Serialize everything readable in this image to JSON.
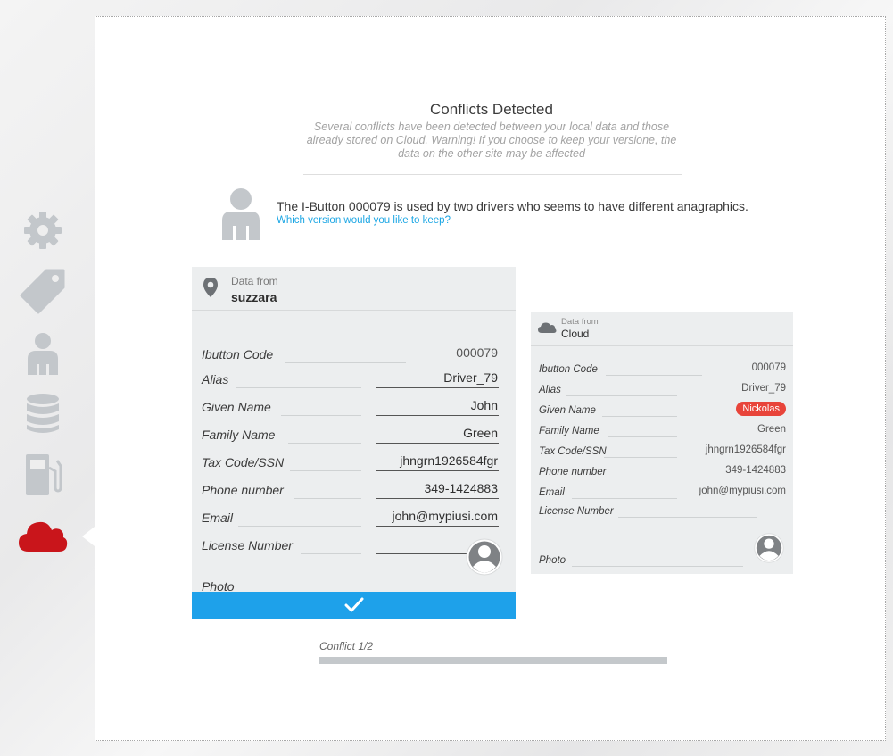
{
  "sidebar": {
    "items": [
      {
        "name": "settings",
        "icon": "gear-icon"
      },
      {
        "name": "tags",
        "icon": "tag-icon"
      },
      {
        "name": "drivers",
        "icon": "person-icon"
      },
      {
        "name": "database",
        "icon": "database-icon"
      },
      {
        "name": "fuel",
        "icon": "fuel-pump-icon"
      },
      {
        "name": "cloud",
        "icon": "cloud-icon",
        "active": true
      }
    ],
    "active_color": "#c9151b",
    "inactive_color": "#c3c7cb"
  },
  "header": {
    "title": "Conflicts Detected",
    "subtitle": "Several conflicts have been detected between your local data and those already stored on Cloud. Warning! If you choose to keep your versione, the data on the other site may be affected"
  },
  "notice": {
    "text": "The I-Button 000079 is used by two drivers who seems to have different anagraphics.",
    "question": "Which version would you like to keep?"
  },
  "local_card": {
    "source_label": "Data from",
    "source_name": "suzzara",
    "fields": [
      {
        "label": "Ibutton Code",
        "value": "000079"
      },
      {
        "label": "Alias",
        "value": "Driver_79"
      },
      {
        "label": "Given Name",
        "value": "John"
      },
      {
        "label": "Family Name",
        "value": "Green"
      },
      {
        "label": "Tax Code/SSN",
        "value": "jhngrn1926584fgr"
      },
      {
        "label": "Phone number",
        "value": "349-1424883"
      },
      {
        "label": "Email",
        "value": "john@mypiusi.com"
      },
      {
        "label": "License Number",
        "value": ""
      },
      {
        "label": "Photo",
        "value": ""
      }
    ],
    "confirm_icon": "checkmark-icon"
  },
  "cloud_card": {
    "source_label": "Data from",
    "source_name": "Cloud",
    "fields": [
      {
        "label": "Ibutton Code",
        "value": "000079"
      },
      {
        "label": "Alias",
        "value": "Driver_79"
      },
      {
        "label": "Given Name",
        "value": "Nickolas"
      },
      {
        "label": "Family Name",
        "value": "Green"
      },
      {
        "label": "Tax Code/SSN",
        "value": "jhngrn1926584fgr"
      },
      {
        "label": "Phone number",
        "value": "349-1424883"
      },
      {
        "label": "Email",
        "value": "john@mypiusi.com"
      },
      {
        "label": "License Number",
        "value": ""
      },
      {
        "label": "Photo",
        "value": ""
      }
    ]
  },
  "progress": {
    "label": "Conflict 1/2",
    "current": 1,
    "total": 2
  },
  "colors": {
    "accent": "#1ea1ea",
    "link": "#1ba6e4",
    "conflict": "#e8443a"
  }
}
